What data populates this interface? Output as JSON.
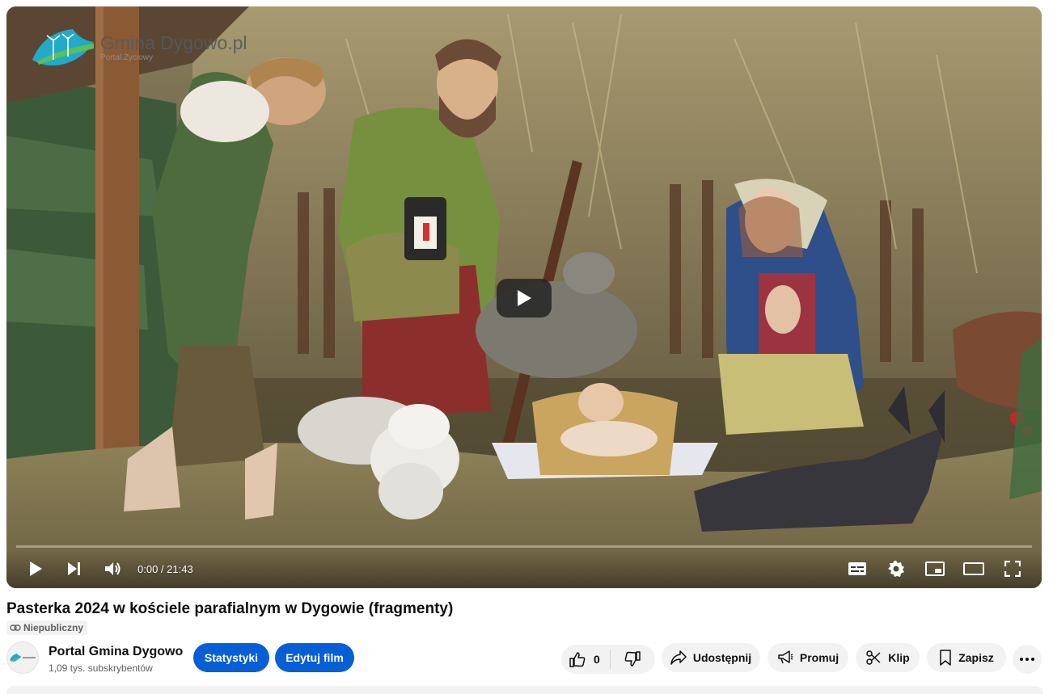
{
  "player": {
    "watermark": {
      "title": "Gmina Dygowo.pl",
      "subtitle": "Portal Życiowy"
    },
    "time": {
      "current": "0:00",
      "separator": " / ",
      "duration": "21:43"
    },
    "progress_fraction": 0.0
  },
  "video": {
    "title": "Pasterka 2024 w kościele parafialnym w Dygowie (fragmenty)",
    "visibility": "Niepubliczny"
  },
  "channel": {
    "name": "Portal Gmina Dygowo",
    "subscribers": "1,09 tys. subskrybentów"
  },
  "actions": {
    "stats": "Statystyki",
    "edit": "Edytuj film",
    "like_count": "0",
    "share": "Udostępnij",
    "promote": "Promuj",
    "clip": "Klip",
    "save": "Zapisz"
  },
  "colors": {
    "primary_blue": "#065fd4",
    "pill_grey": "#f2f2f2",
    "text_primary": "#0f0f0f",
    "text_secondary": "#606060"
  }
}
